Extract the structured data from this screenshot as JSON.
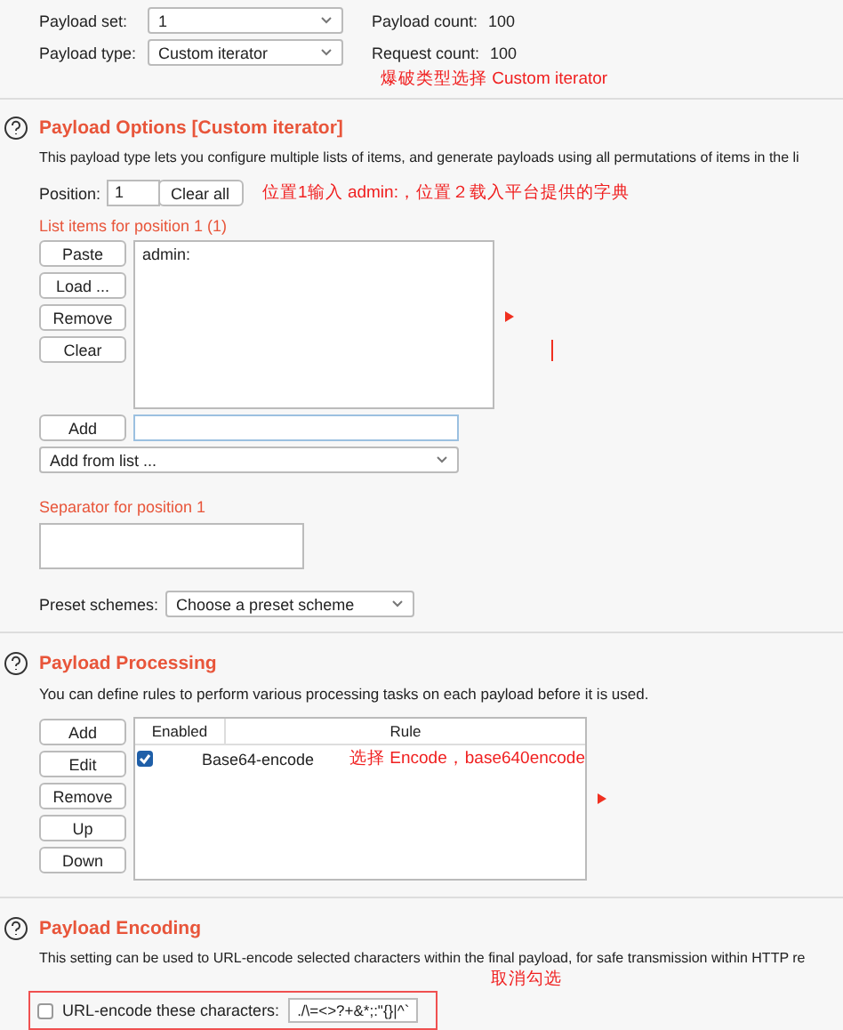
{
  "payload_settings": {
    "set_label": "Payload set:",
    "set_value": "1",
    "type_label": "Payload type:",
    "type_value": "Custom iterator",
    "count_label": "Payload count:",
    "count_value": "100",
    "request_label": "Request count:",
    "request_value": "100",
    "annotation": "爆破类型选择 Custom iterator"
  },
  "payload_options": {
    "title": "Payload Options [Custom iterator]",
    "description": "This payload type lets you configure multiple lists of items, and generate payloads using all permutations of items in the li",
    "position_label": "Position:",
    "position_value": "1",
    "clear_all": "Clear all",
    "annotation": "位置1输入 admin:，位置２载入平台提供的字典",
    "list_label": "List items for position 1 (1)",
    "list_buttons": [
      "Paste",
      "Load ...",
      "Remove",
      "Clear"
    ],
    "list_items": [
      "admin:"
    ],
    "add_button": "Add",
    "add_from_list": "Add from list ...",
    "separator_label": "Separator for position 1",
    "preset_label": "Preset schemes:",
    "preset_value": "Choose a preset scheme"
  },
  "payload_processing": {
    "title": "Payload Processing",
    "description": "You can define rules to perform various processing tasks on each payload before it is used.",
    "buttons": [
      "Add",
      "Edit",
      "Remove",
      "Up",
      "Down"
    ],
    "columns": [
      "Enabled",
      "Rule"
    ],
    "rows": [
      {
        "enabled": true,
        "rule": "Base64-encode"
      }
    ],
    "annotation": "选择 Encode，base640encode"
  },
  "payload_encoding": {
    "title": "Payload Encoding",
    "description": "This setting can be used to URL-encode selected characters within the final payload, for safe transmission within HTTP re",
    "checkbox_label": "URL-encode these characters:",
    "checked": false,
    "characters": "./\\=<>?+&*;:\"{}|^`",
    "annotation": "取消勾选"
  }
}
